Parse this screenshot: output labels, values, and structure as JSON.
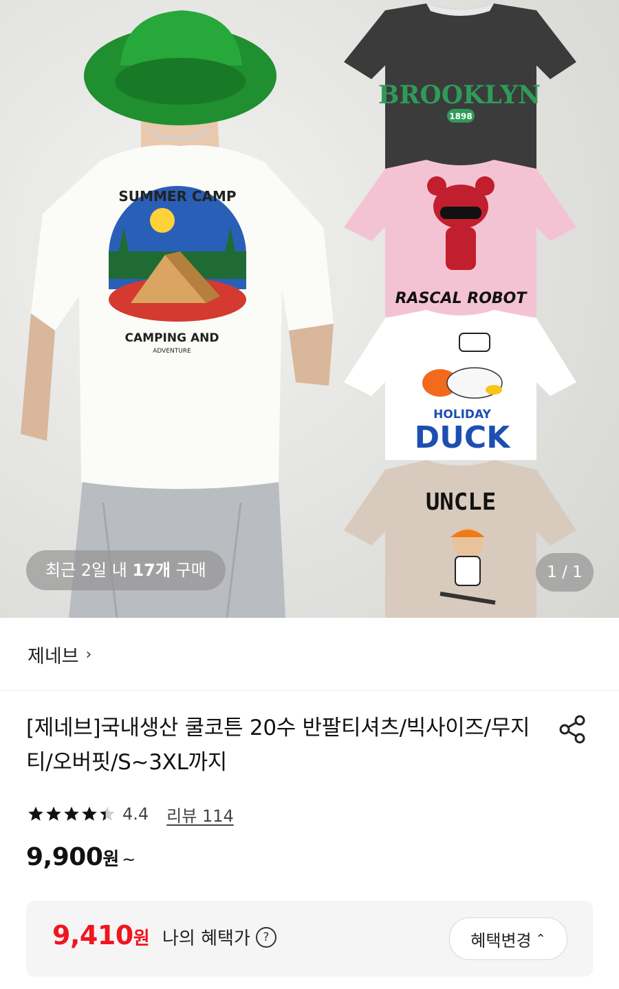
{
  "gallery": {
    "recent_purchase": {
      "prefix": "최근 2일 내 ",
      "count": "17개",
      "suffix": " 구매"
    },
    "page_counter": "1 / 1",
    "image_texts": {
      "camp_top": "SUMMER CAMP",
      "camp_bottom": "CAMPING AND",
      "camp_sub": "ADVENTURE",
      "brooklyn": "BROOKLYN",
      "brooklyn_year": "1898",
      "rascal": "RASCAL ROBOT",
      "holiday": "HOLIDAY",
      "duck": "DUCK",
      "uncle": "UNCLE"
    }
  },
  "seller": {
    "name": "제네브",
    "chevron": "›"
  },
  "product": {
    "title": "[제네브]국내생산 쿨코튼 20수 반팔티셔츠/빅사이즈/무지티/오버핏/S~3XL까지",
    "rating": {
      "value": "4.4",
      "stars": 4.4,
      "review_label": "리뷰 114"
    },
    "price": {
      "amount": "9,900",
      "unit": "원",
      "suffix": "~"
    }
  },
  "benefit": {
    "amount": "9,410",
    "unit": "원",
    "label": "나의 혜택가",
    "help_glyph": "?",
    "change_button": "혜택변경",
    "change_caret": "⌃"
  },
  "colors": {
    "accent": "#f0151f",
    "text": "#111111",
    "pill_bg": "#969696",
    "box_bg": "#f5f5f5"
  },
  "icons": {
    "share": "share-icon",
    "help": "help-icon",
    "chevron": "chevron-right-icon",
    "star": "star-icon"
  }
}
